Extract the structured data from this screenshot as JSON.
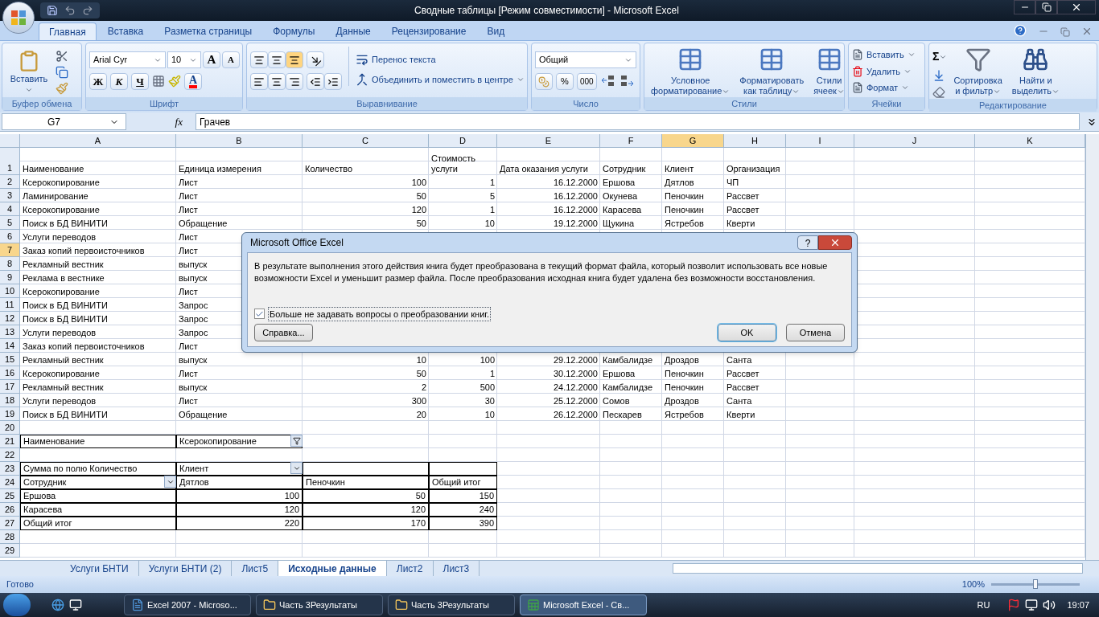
{
  "title_bar": {
    "title": "Сводные таблицы  [Режим совместимости] - Microsoft Excel"
  },
  "ribbon": {
    "tabs": [
      {
        "label": "Главная",
        "selected": true
      },
      {
        "label": "Вставка",
        "selected": false
      },
      {
        "label": "Разметка страницы",
        "selected": false
      },
      {
        "label": "Формулы",
        "selected": false
      },
      {
        "label": "Данные",
        "selected": false
      },
      {
        "label": "Рецензирование",
        "selected": false
      },
      {
        "label": "Вид",
        "selected": false
      }
    ],
    "clipboard": {
      "title": "Буфер обмена",
      "paste": "Вставить"
    },
    "font": {
      "title": "Шрифт",
      "family": "Arial Cyr",
      "size": "10",
      "grow": "A",
      "shrink": "A",
      "bold": "Ж",
      "italic": "К",
      "underline": "Ч",
      "font_color_letter": "A"
    },
    "alignment": {
      "title": "Выравнивание",
      "vertical": [
        {
          "selected": false
        },
        {
          "selected": false
        },
        {
          "selected": true
        }
      ],
      "wrap": "Перенос текста",
      "merge": "Объединить и поместить в центре"
    },
    "number": {
      "title": "Число",
      "format": "Общий",
      "percent": "%",
      "thousands": "000"
    },
    "styles": {
      "title": "Стили",
      "buttons": [
        [
          "Условное",
          "форматирование"
        ],
        [
          "Форматировать",
          "как таблицу"
        ],
        [
          "Стили",
          "ячеек"
        ]
      ]
    },
    "cells": {
      "title": "Ячейки",
      "buttons": [
        "Вставить",
        "Удалить",
        "Формат"
      ]
    },
    "editing": {
      "title": "Редактирование",
      "sum": "Σ",
      "buttons": [
        [
          "Сортировка",
          "и фильтр"
        ],
        [
          "Найти и",
          "выделить"
        ]
      ]
    }
  },
  "formula_bar": {
    "name_box": "G7",
    "fx": "fx",
    "value": "Грачев"
  },
  "sheet": {
    "columns": [
      {
        "label": "A",
        "selected": false
      },
      {
        "label": "B",
        "selected": false
      },
      {
        "label": "C",
        "selected": false
      },
      {
        "label": "D",
        "selected": false
      },
      {
        "label": "E",
        "selected": false
      },
      {
        "label": "F",
        "selected": false
      },
      {
        "label": "G",
        "selected": true
      },
      {
        "label": "H",
        "selected": false
      },
      {
        "label": "I",
        "selected": false
      },
      {
        "label": "J",
        "selected": false
      },
      {
        "label": "K",
        "selected": false
      }
    ],
    "rows": [
      {
        "label": "1",
        "selected": false,
        "tall": true,
        "cells": {
          "A": {
            "text": "Наименование"
          },
          "B": {
            "text": "Единица измерения"
          },
          "C": {
            "text": "Количество"
          },
          "D": {
            "text": "Стоимость услуги"
          },
          "E": {
            "text": "Дата оказания услуги"
          },
          "F": {
            "text": "Сотрудник"
          },
          "G": {
            "text": "Клиент"
          },
          "H": {
            "text": "Организация"
          }
        }
      },
      {
        "label": "2",
        "selected": false,
        "cells": {
          "A": {
            "text": "Ксерокопирование"
          },
          "B": {
            "text": "Лист"
          },
          "C": {
            "text": "100",
            "kind": "number"
          },
          "D": {
            "text": "1",
            "kind": "number"
          },
          "E": {
            "text": "16.12.2000",
            "kind": "number"
          },
          "F": {
            "text": "Ершова"
          },
          "G": {
            "text": "Дятлов"
          },
          "H": {
            "text": "ЧП"
          }
        }
      },
      {
        "label": "3",
        "selected": false,
        "cells": {
          "A": {
            "text": "Ламинирование"
          },
          "B": {
            "text": "Лист"
          },
          "C": {
            "text": "50",
            "kind": "number"
          },
          "D": {
            "text": "5",
            "kind": "number"
          },
          "E": {
            "text": "16.12.2000",
            "kind": "number"
          },
          "F": {
            "text": "Окунева"
          },
          "G": {
            "text": "Пеночкин"
          },
          "H": {
            "text": "Рассвет"
          }
        }
      },
      {
        "label": "4",
        "selected": false,
        "cells": {
          "A": {
            "text": "Ксерокопирование"
          },
          "B": {
            "text": "Лист"
          },
          "C": {
            "text": "120",
            "kind": "number"
          },
          "D": {
            "text": "1",
            "kind": "number"
          },
          "E": {
            "text": "16.12.2000",
            "kind": "number"
          },
          "F": {
            "text": "Карасева"
          },
          "G": {
            "text": "Пеночкин"
          },
          "H": {
            "text": "Рассвет"
          }
        }
      },
      {
        "label": "5",
        "selected": false,
        "cells": {
          "A": {
            "text": "Поиск в БД ВИНИТИ"
          },
          "B": {
            "text": "Обращение"
          },
          "C": {
            "text": "50",
            "kind": "number"
          },
          "D": {
            "text": "10",
            "kind": "number"
          },
          "E": {
            "text": "19.12.2000",
            "kind": "number"
          },
          "F": {
            "text": "Щукина"
          },
          "G": {
            "text": "Ястребов"
          },
          "H": {
            "text": "Кверти"
          }
        }
      },
      {
        "label": "6",
        "selected": false,
        "cells": {
          "A": {
            "text": "Услуги переводов"
          },
          "B": {
            "text": "Лист"
          }
        }
      },
      {
        "label": "7",
        "selected": true,
        "cells": {
          "A": {
            "text": "Заказ копий первоисточников"
          },
          "B": {
            "text": "Лист"
          }
        }
      },
      {
        "label": "8",
        "selected": false,
        "cells": {
          "A": {
            "text": "Рекламный вестник"
          },
          "B": {
            "text": "выпуск"
          }
        }
      },
      {
        "label": "9",
        "selected": false,
        "cells": {
          "A": {
            "text": "Реклама в вестнике"
          },
          "B": {
            "text": "выпуск"
          }
        }
      },
      {
        "label": "10",
        "selected": false,
        "cells": {
          "A": {
            "text": "Ксерокопирование"
          },
          "B": {
            "text": "Лист"
          }
        }
      },
      {
        "label": "11",
        "selected": false,
        "cells": {
          "A": {
            "text": "Поиск в БД ВИНИТИ"
          },
          "B": {
            "text": "Запрос"
          }
        }
      },
      {
        "label": "12",
        "selected": false,
        "cells": {
          "A": {
            "text": "Поиск в БД ВИНИТИ"
          },
          "B": {
            "text": "Запрос"
          }
        }
      },
      {
        "label": "13",
        "selected": false,
        "cells": {
          "A": {
            "text": "Услуги переводов"
          },
          "B": {
            "text": "Запрос"
          }
        }
      },
      {
        "label": "14",
        "selected": false,
        "cells": {
          "A": {
            "text": "Заказ копий первоисточников"
          },
          "B": {
            "text": "Лист"
          }
        }
      },
      {
        "label": "15",
        "selected": false,
        "cells": {
          "A": {
            "text": "Рекламный вестник"
          },
          "B": {
            "text": "выпуск"
          },
          "C": {
            "text": "10",
            "kind": "number"
          },
          "D": {
            "text": "100",
            "kind": "number"
          },
          "E": {
            "text": "29.12.2000",
            "kind": "number"
          },
          "F": {
            "text": "Камбалидзе"
          },
          "G": {
            "text": "Дроздов"
          },
          "H": {
            "text": "Санта"
          }
        }
      },
      {
        "label": "16",
        "selected": false,
        "cells": {
          "A": {
            "text": "Ксерокопирование"
          },
          "B": {
            "text": "Лист"
          },
          "C": {
            "text": "50",
            "kind": "number"
          },
          "D": {
            "text": "1",
            "kind": "number"
          },
          "E": {
            "text": "30.12.2000",
            "kind": "number"
          },
          "F": {
            "text": "Ершова"
          },
          "G": {
            "text": "Пеночкин"
          },
          "H": {
            "text": "Рассвет"
          }
        }
      },
      {
        "label": "17",
        "selected": false,
        "cells": {
          "A": {
            "text": "Рекламный вестник"
          },
          "B": {
            "text": "выпуск"
          },
          "C": {
            "text": "2",
            "kind": "number"
          },
          "D": {
            "text": "500",
            "kind": "number"
          },
          "E": {
            "text": "24.12.2000",
            "kind": "number"
          },
          "F": {
            "text": "Камбалидзе"
          },
          "G": {
            "text": "Пеночкин"
          },
          "H": {
            "text": "Рассвет"
          }
        }
      },
      {
        "label": "18",
        "selected": false,
        "cells": {
          "A": {
            "text": "Услуги переводов"
          },
          "B": {
            "text": "Лист"
          },
          "C": {
            "text": "300",
            "kind": "number"
          },
          "D": {
            "text": "30",
            "kind": "number"
          },
          "E": {
            "text": "25.12.2000",
            "kind": "number"
          },
          "F": {
            "text": "Сомов"
          },
          "G": {
            "text": "Дроздов"
          },
          "H": {
            "text": "Санта"
          }
        }
      },
      {
        "label": "19",
        "selected": false,
        "cells": {
          "A": {
            "text": "Поиск в БД ВИНИТИ"
          },
          "B": {
            "text": "Обращение"
          },
          "C": {
            "text": "20",
            "kind": "number"
          },
          "D": {
            "text": "10",
            "kind": "number"
          },
          "E": {
            "text": "26.12.2000",
            "kind": "number"
          },
          "F": {
            "text": "Пескарев"
          },
          "G": {
            "text": "Ястребов"
          },
          "H": {
            "text": "Кверти"
          }
        }
      },
      {
        "label": "20",
        "selected": false
      },
      {
        "label": "21",
        "selected": false,
        "cells": {
          "A": {
            "text": "Наименование",
            "boxed": true
          },
          "B": {
            "text": "Ксерокопирование",
            "boxed": true,
            "filter_button": true
          }
        }
      },
      {
        "label": "22",
        "selected": false
      },
      {
        "label": "23",
        "selected": false,
        "cells": {
          "A": {
            "text": "Сумма по полю Количество",
            "boxed": true
          },
          "B": {
            "text": "Клиент",
            "boxed": true,
            "dropdown_button": true
          },
          "C": {
            "boxed": true
          },
          "D": {
            "boxed": true
          }
        }
      },
      {
        "label": "24",
        "selected": false,
        "cells": {
          "A": {
            "text": "Сотрудник",
            "boxed": true,
            "dropdown_button": true
          },
          "B": {
            "text": "Дятлов",
            "boxed": true
          },
          "C": {
            "text": "Пеночкин",
            "boxed": true
          },
          "D": {
            "text": "Общий итог",
            "boxed": true
          }
        }
      },
      {
        "label": "25",
        "selected": false,
        "cells": {
          "A": {
            "text": "Ершова",
            "boxed": true
          },
          "B": {
            "text": "100",
            "kind": "number",
            "boxed": true
          },
          "C": {
            "text": "50",
            "kind": "number",
            "boxed": true
          },
          "D": {
            "text": "150",
            "kind": "number",
            "boxed": true
          }
        }
      },
      {
        "label": "26",
        "selected": false,
        "cells": {
          "A": {
            "text": "Карасева",
            "boxed": true
          },
          "B": {
            "text": "120",
            "kind": "number",
            "boxed": true
          },
          "C": {
            "text": "120",
            "kind": "number",
            "boxed": true
          },
          "D": {
            "text": "240",
            "kind": "number",
            "boxed": true
          }
        }
      },
      {
        "label": "27",
        "selected": false,
        "cells": {
          "A": {
            "text": "Общий итог",
            "boxed": true
          },
          "B": {
            "text": "220",
            "kind": "number",
            "boxed": true
          },
          "C": {
            "text": "170",
            "kind": "number",
            "boxed": true
          },
          "D": {
            "text": "390",
            "kind": "number",
            "boxed": true
          }
        }
      },
      {
        "label": "28",
        "selected": false
      },
      {
        "label": "29",
        "selected": false
      }
    ]
  },
  "sheet_tabs": [
    {
      "label": "Услуги БНТИ",
      "selected": false
    },
    {
      "label": "Услуги БНТИ (2)",
      "selected": false
    },
    {
      "label": "Лист5",
      "selected": false
    },
    {
      "label": "Исходные данные",
      "selected": true
    },
    {
      "label": "Лист2",
      "selected": false
    },
    {
      "label": "Лист3",
      "selected": false
    }
  ],
  "status_bar": {
    "ready": "Готово",
    "zoom": "100%",
    "level": 0.5
  },
  "taskbar": {
    "items": [
      {
        "label": "Excel 2007 - Microso...",
        "kind": "word",
        "selected": false
      },
      {
        "label": "Часть 3Результаты",
        "kind": "folder",
        "selected": false
      },
      {
        "label": "Часть 3Результаты",
        "kind": "folder",
        "selected": false
      },
      {
        "label": "Microsoft Excel - Св...",
        "kind": "excel",
        "selected": true
      }
    ],
    "language": "RU",
    "time": "19:07"
  },
  "dialog": {
    "title": "Microsoft Office Excel",
    "help": "?",
    "message": "В результате выполнения этого действия книга будет преобразована в текущий формат файла, который позволит использовать все новые возможности Excel и уменьшит размер файла. После преобразования исходная книга будет удалена без возможности восстановления.",
    "checkbox": {
      "label": "Больше не задавать вопросы о преобразовании книг.",
      "checked": true
    },
    "buttons": [
      {
        "label": "Справка...",
        "kind": "help"
      },
      {
        "label": "OK",
        "kind": "default"
      },
      {
        "label": "Отмена",
        "kind": "cancel"
      }
    ]
  }
}
